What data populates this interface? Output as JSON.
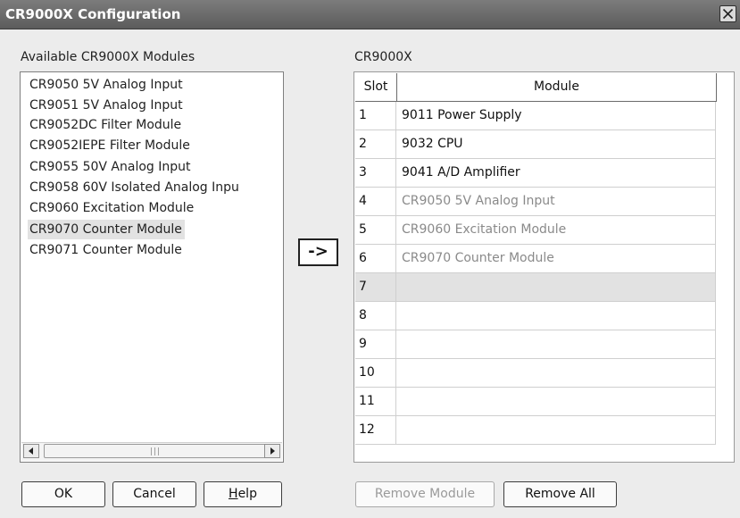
{
  "window": {
    "title": "CR9000X Configuration",
    "close_icon": "close-icon"
  },
  "available": {
    "label": "Available CR9000X Modules",
    "items": [
      {
        "label": "CR9050 5V Analog Input",
        "selected": false
      },
      {
        "label": "CR9051 5V Analog Input",
        "selected": false
      },
      {
        "label": "CR9052DC Filter Module",
        "selected": false
      },
      {
        "label": "CR9052IEPE Filter Module",
        "selected": false
      },
      {
        "label": "CR9055 50V Analog Input",
        "selected": false
      },
      {
        "label": "CR9058 60V Isolated Analog Inpu",
        "selected": false
      },
      {
        "label": "CR9060 Excitation Module",
        "selected": false
      },
      {
        "label": "CR9070 Counter Module",
        "selected": true
      },
      {
        "label": "CR9071 Counter Module",
        "selected": false
      }
    ],
    "scroll_grip": "|||"
  },
  "add_button": {
    "label": "->"
  },
  "config": {
    "label": "CR9000X",
    "columns": {
      "slot": "Slot",
      "module": "Module"
    },
    "rows": [
      {
        "slot": "1",
        "module": "9011 Power Supply",
        "dim": false
      },
      {
        "slot": "2",
        "module": "9032 CPU",
        "dim": false
      },
      {
        "slot": "3",
        "module": "9041 A/D Amplifier",
        "dim": false
      },
      {
        "slot": "4",
        "module": "CR9050 5V Analog Input",
        "dim": true
      },
      {
        "slot": "5",
        "module": "CR9060 Excitation Module",
        "dim": true
      },
      {
        "slot": "6",
        "module": "CR9070 Counter Module",
        "dim": true
      },
      {
        "slot": "7",
        "module": "",
        "dim": false,
        "selected": true
      },
      {
        "slot": "8",
        "module": "",
        "dim": false
      },
      {
        "slot": "9",
        "module": "",
        "dim": false
      },
      {
        "slot": "10",
        "module": "",
        "dim": false
      },
      {
        "slot": "11",
        "module": "",
        "dim": false
      },
      {
        "slot": "12",
        "module": "",
        "dim": false
      }
    ]
  },
  "buttons": {
    "ok": "OK",
    "cancel": "Cancel",
    "help_accel": "H",
    "help_rest": "elp",
    "remove_module": "Remove Module",
    "remove_all": "Remove All"
  },
  "colors": {
    "titlebar": "#6c6c6c",
    "selection": "#e2e2e2",
    "disabled_text": "#9a9a9a"
  }
}
